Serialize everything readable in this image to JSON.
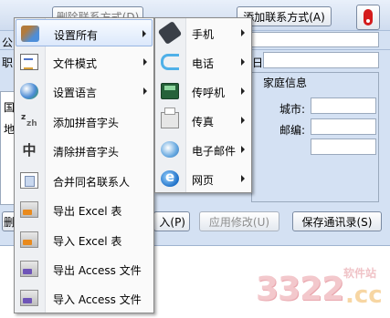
{
  "window": {
    "add_contact_button": "添加联系方式(A)",
    "hidden_button_text": "删除联系方式(D)",
    "fragment_gong": "公",
    "fragment_zhi": "职",
    "fragment_guo": "国",
    "fragment_di": "地",
    "fragment_fan": "删",
    "fragment_ri": "日:",
    "home_info_group": "家庭信息",
    "city_label": "城市:",
    "zip_label": "邮编:",
    "import_fragment": "入(P)",
    "apply_button": "应用修改(U)",
    "save_button": "保存通讯录(S)"
  },
  "main_menu": {
    "items": [
      {
        "label": "设置所有",
        "icon": "tools-icon",
        "submenu": true,
        "selected": true
      },
      {
        "label": "文件模式",
        "icon": "document-mode-icon",
        "submenu": true
      },
      {
        "label": "设置语言",
        "icon": "globe-language-icon",
        "submenu": true
      },
      {
        "label": "添加拼音字头",
        "icon": "pinyin-add-icon"
      },
      {
        "label": "清除拼音字头",
        "icon": "pinyin-clear-icon"
      },
      {
        "label": "合并同名联系人",
        "icon": "merge-contacts-icon"
      },
      {
        "label": "导出 Excel 表",
        "icon": "excel-export-icon"
      },
      {
        "label": "导入 Excel 表",
        "icon": "excel-import-icon"
      },
      {
        "label": "导出 Access 文件",
        "icon": "access-export-icon"
      },
      {
        "label": "导入 Access 文件",
        "icon": "access-import-icon"
      }
    ]
  },
  "sub_menu": {
    "items": [
      {
        "label": "手机",
        "icon": "mobile-phone-icon"
      },
      {
        "label": "电话",
        "icon": "telephone-icon"
      },
      {
        "label": "传呼机",
        "icon": "pager-icon"
      },
      {
        "label": "传真",
        "icon": "fax-icon"
      },
      {
        "label": "电子邮件",
        "icon": "email-icon"
      },
      {
        "label": "网页",
        "icon": "webpage-icon"
      }
    ]
  },
  "watermark": {
    "number": "3322",
    "suffix": ".cc",
    "site_label": "软件站"
  },
  "colors": {
    "window_bg": "#d4e1f3",
    "menu_bg": "#fafafa",
    "menu_highlight_border": "#98b5e2",
    "watermark_pink": "#f3c8cc",
    "watermark_orange": "#f7d6a3"
  }
}
